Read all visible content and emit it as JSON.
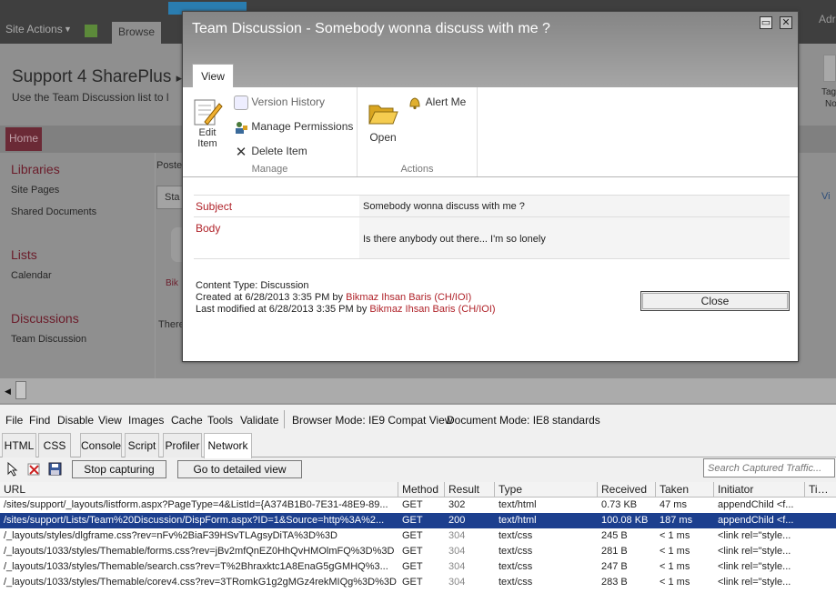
{
  "sharepoint": {
    "site_actions": "Site Actions",
    "browse_tab": "Browse",
    "addr_partial": "Adr",
    "title": "Support 4 SharePlus",
    "subtitle": "Use the Team Discussion list to l",
    "home": "Home",
    "libraries": "Libraries",
    "site_pages": "Site Pages",
    "shared_documents": "Shared Documents",
    "lists": "Lists",
    "calendar": "Calendar",
    "discussions": "Discussions",
    "team_discussion": "Team Discussion",
    "posts_partial": "Poste",
    "star_partial": "Sta",
    "vi_partial": "Vi",
    "there_partial": "There",
    "bik_partial": "Bik",
    "tag_partial": "Tag",
    "no_partial": "No"
  },
  "dialog": {
    "title": "Team Discussion - Somebody wonna discuss with me ?",
    "tab_view": "View",
    "edit_item": "Edit Item",
    "version_history": "Version History",
    "manage_permissions": "Manage Permissions",
    "delete_item": "Delete Item",
    "group_manage": "Manage",
    "open": "Open",
    "alert_me": "Alert Me",
    "group_actions": "Actions",
    "subject_label": "Subject",
    "subject_value": "Somebody wonna discuss with me ?",
    "body_label": "Body",
    "body_value": "Is there anybody out there... I'm so lonely",
    "content_type": "Content Type: Discussion",
    "created_prefix": "Created at 6/28/2013 3:35 PM by",
    "created_by": "Bikmaz Ihsan Baris (CH/IOI)",
    "modified_prefix": "Last modified at 6/28/2013 3:35 PM by",
    "modified_by": "Bikmaz Ihsan Baris (CH/IOI)",
    "close": "Close"
  },
  "devtools": {
    "menu": [
      "File",
      "Find",
      "Disable",
      "View",
      "Images",
      "Cache",
      "Tools",
      "Validate"
    ],
    "browser_mode": "Browser Mode: IE9 Compat View",
    "document_mode": "Document Mode: IE8 standards",
    "tabs": [
      "HTML",
      "CSS",
      "Console",
      "Script",
      "Profiler",
      "Network"
    ],
    "active_tab": "Network",
    "search_placeholder": "Search Captured Traffic...",
    "stop_capturing": "Stop capturing",
    "detailed_view": "Go to detailed view",
    "columns": [
      "URL",
      "Method",
      "Result",
      "Type",
      "Received",
      "Taken",
      "Initiator",
      "Timings"
    ],
    "rows": [
      {
        "url": "/sites/support/_layouts/listform.aspx?PageType=4&ListId={A374B1B0-7E31-48E9-89...",
        "method": "GET",
        "result": "302",
        "type": "text/html",
        "received": "0.73 KB",
        "taken": "47 ms",
        "initiator": "appendChild <f..."
      },
      {
        "url": "/sites/support/Lists/Team%20Discussion/DispForm.aspx?ID=1&Source=http%3A%2...",
        "method": "GET",
        "result": "200",
        "type": "text/html",
        "received": "100.08 KB",
        "taken": "187 ms",
        "initiator": "appendChild <f..."
      },
      {
        "url": "/_layouts/styles/dlgframe.css?rev=nFv%2BiaF39HSvTLAgsyDiTA%3D%3D",
        "method": "GET",
        "result": "304",
        "type": "text/css",
        "received": "245 B",
        "taken": "< 1 ms",
        "initiator": "<link rel=\"style..."
      },
      {
        "url": "/_layouts/1033/styles/Themable/forms.css?rev=jBv2mfQnEZ0HhQvHMOlmFQ%3D%3D",
        "method": "GET",
        "result": "304",
        "type": "text/css",
        "received": "281 B",
        "taken": "< 1 ms",
        "initiator": "<link rel=\"style..."
      },
      {
        "url": "/_layouts/1033/styles/Themable/search.css?rev=T%2Bhraxktc1A8EnaG5gGMHQ%3...",
        "method": "GET",
        "result": "304",
        "type": "text/css",
        "received": "247 B",
        "taken": "< 1 ms",
        "initiator": "<link rel=\"style..."
      },
      {
        "url": "/_layouts/1033/styles/Themable/corev4.css?rev=3TRomkG1g2gMGz4rekMIQg%3D%3D",
        "method": "GET",
        "result": "304",
        "type": "text/css",
        "received": "283 B",
        "taken": "< 1 ms",
        "initiator": "<link rel=\"style..."
      }
    ],
    "selected_row": 1
  }
}
